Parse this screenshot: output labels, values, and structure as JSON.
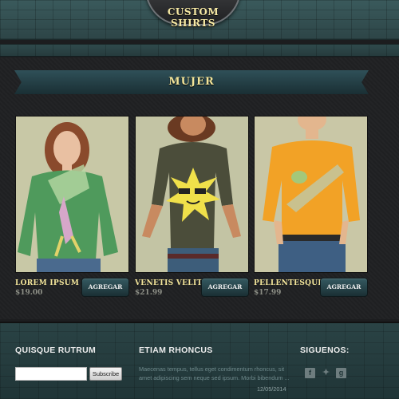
{
  "header": {
    "logo_text": "CUSTOM SHIRTS"
  },
  "section": {
    "title": "MUJER"
  },
  "products": [
    {
      "name": "LOREM IPSUM",
      "price": "$19.00",
      "button": "AGREGAR",
      "shirt_color": "#4f9a5c"
    },
    {
      "name": "VENETIS VELIT",
      "price": "$21.99",
      "button": "AGREGAR",
      "shirt_color": "#4b4d3a"
    },
    {
      "name": "PELLENTESQUE",
      "price": "$17.99",
      "button": "AGREGAR",
      "shirt_color": "#f2a226"
    }
  ],
  "footer": {
    "newsletter": {
      "heading": "QUISQUE RUTRUM",
      "input_value": "",
      "button": "Subscribe"
    },
    "news": {
      "heading": "ETIAM RHONCUS",
      "excerpt": "Maecenas tempus, tellus eget condimentum rhoncus, sit amet adipiscing sem neque sed ipsum. Morbi bibendum ...",
      "date": "12/05/2014"
    },
    "social": {
      "heading": "SIGUENOS:",
      "icons": [
        "facebook-icon",
        "twitter-icon",
        "google-plus-icon"
      ]
    }
  },
  "colors": {
    "accent_gold": "#f3e59a",
    "teal_header": "#2d4547",
    "dark_background": "#1f2022"
  }
}
